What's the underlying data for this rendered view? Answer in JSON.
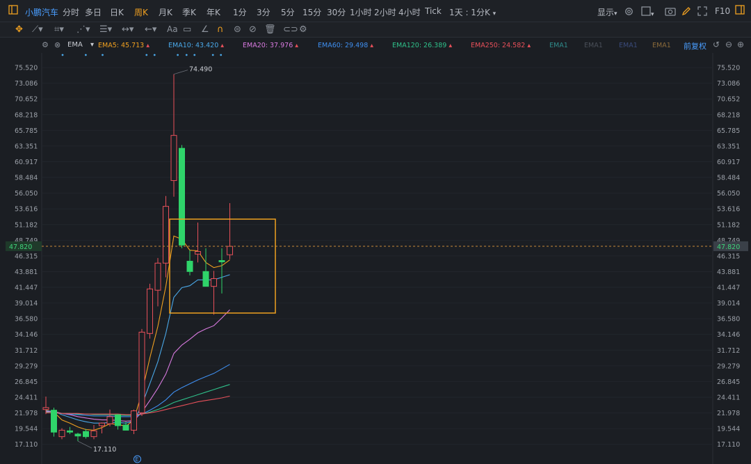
{
  "topbar": {
    "stock_name": "小鹏汽车",
    "periods": [
      "分时",
      "多日",
      "日K",
      "周K",
      "月K",
      "季K",
      "年K",
      "1分",
      "3分",
      "5分",
      "15分",
      "30分",
      "1小时",
      "2小时",
      "4小时",
      "Tick"
    ],
    "active_period": "周K",
    "custom_period": "1天 : 1分K",
    "display_label": "显示",
    "fullscreen_icon": "fullscreen-icon",
    "f10_label": "F10"
  },
  "toolbar": {
    "restore_label": "前复权"
  },
  "legend": {
    "indicator": "EMA",
    "items": [
      {
        "label": "EMA5: 45.713",
        "color": "#f0a020"
      },
      {
        "label": "EMA10: 43.420",
        "color": "#4aa8e8"
      },
      {
        "label": "EMA20: 37.976",
        "color": "#d87adf"
      },
      {
        "label": "EMA60: 29.498",
        "color": "#3f8ff0"
      },
      {
        "label": "EMA120: 26.389",
        "color": "#2fc08a"
      },
      {
        "label": "EMA250: 24.582",
        "color": "#e8505a"
      },
      {
        "label": "EMA1",
        "color": "#2f8a8a"
      },
      {
        "label": "EMA1",
        "color": "#4a4f58"
      },
      {
        "label": "EMA1",
        "color": "#3a4a7a"
      },
      {
        "label": "EMA1",
        "color": "#8a6a3a"
      }
    ]
  },
  "chart_data": {
    "type": "candlestick",
    "ylim": [
      16.0,
      76.5
    ],
    "y_ticks": [
      "75.520",
      "73.086",
      "70.652",
      "68.218",
      "65.785",
      "63.351",
      "60.917",
      "58.484",
      "56.050",
      "53.616",
      "51.182",
      "48.749",
      "46.315",
      "43.881",
      "41.447",
      "39.014",
      "36.580",
      "34.146",
      "31.712",
      "29.279",
      "26.845",
      "24.411",
      "21.978",
      "19.544",
      "17.110"
    ],
    "current_price": "47.820",
    "current_value": 47.82,
    "high_annotation": "74.490",
    "low_annotation": "17.110",
    "event_marker": "E",
    "candles": [
      {
        "o": 22.5,
        "h": 24.5,
        "l": 21.8,
        "c": 22.8
      },
      {
        "o": 22.4,
        "h": 22.8,
        "l": 18.3,
        "c": 19.0
      },
      {
        "o": 18.3,
        "h": 19.6,
        "l": 17.9,
        "c": 19.3
      },
      {
        "o": 19.2,
        "h": 19.8,
        "l": 18.7,
        "c": 19.0
      },
      {
        "o": 18.7,
        "h": 18.9,
        "l": 17.6,
        "c": 18.4
      },
      {
        "o": 19.1,
        "h": 19.5,
        "l": 18.0,
        "c": 18.3
      },
      {
        "o": 18.3,
        "h": 20.1,
        "l": 17.9,
        "c": 19.2
      },
      {
        "o": 20.0,
        "h": 20.5,
        "l": 18.8,
        "c": 20.4
      },
      {
        "o": 20.3,
        "h": 22.5,
        "l": 19.9,
        "c": 21.4
      },
      {
        "o": 21.7,
        "h": 21.8,
        "l": 19.4,
        "c": 20.0
      },
      {
        "o": 20.1,
        "h": 20.6,
        "l": 19.6,
        "c": 19.3
      },
      {
        "o": 19.3,
        "h": 22.5,
        "l": 18.7,
        "c": 22.3
      },
      {
        "o": 22.0,
        "h": 35.0,
        "l": 21.5,
        "c": 34.5
      },
      {
        "o": 34.3,
        "h": 42.0,
        "l": 33.5,
        "c": 41.2
      },
      {
        "o": 41.0,
        "h": 46.0,
        "l": 38.5,
        "c": 45.2
      },
      {
        "o": 45.2,
        "h": 55.6,
        "l": 43.0,
        "c": 54.0
      },
      {
        "o": 58.0,
        "h": 74.49,
        "l": 55.5,
        "c": 65.0
      },
      {
        "o": 63.0,
        "h": 63.5,
        "l": 47.5,
        "c": 48.0
      },
      {
        "o": 45.5,
        "h": 47.2,
        "l": 43.3,
        "c": 43.9
      },
      {
        "o": 46.6,
        "h": 51.5,
        "l": 45.3,
        "c": 47.0
      },
      {
        "o": 43.9,
        "h": 47.5,
        "l": 41.9,
        "c": 41.6
      },
      {
        "o": 41.6,
        "h": 44.0,
        "l": 37.2,
        "c": 42.8
      },
      {
        "o": 45.6,
        "h": 47.5,
        "l": 40.5,
        "c": 45.4
      },
      {
        "o": 46.5,
        "h": 54.5,
        "l": 45.8,
        "c": 47.8
      }
    ],
    "series": [
      {
        "name": "EMA5",
        "color": "#f0a020",
        "values": [
          22.4,
          22.1,
          20.9,
          20.4,
          19.8,
          19.4,
          19.3,
          19.7,
          20.3,
          20.2,
          19.9,
          20.9,
          25.1,
          30.5,
          35.4,
          41.6,
          49.4,
          48.9,
          47.2,
          47.1,
          45.3,
          44.5,
          44.8,
          45.7
        ]
      },
      {
        "name": "EMA10",
        "color": "#4aa8e8",
        "values": [
          22.3,
          22.2,
          21.7,
          21.3,
          20.9,
          20.6,
          20.4,
          20.4,
          20.5,
          20.5,
          20.4,
          20.7,
          23.2,
          26.5,
          29.9,
          34.3,
          39.9,
          41.4,
          41.7,
          42.6,
          42.6,
          42.6,
          43.0,
          43.4
        ]
      },
      {
        "name": "EMA20",
        "color": "#d87adf",
        "values": [
          22.2,
          22.2,
          21.9,
          21.7,
          21.4,
          21.2,
          21.0,
          20.9,
          20.9,
          20.8,
          20.7,
          20.8,
          22.1,
          23.9,
          25.8,
          28.0,
          31.2,
          32.5,
          33.4,
          34.4,
          35.0,
          35.5,
          36.7,
          37.98
        ]
      },
      {
        "name": "EMA60",
        "color": "#3f8ff0",
        "values": [
          22.1,
          22.0,
          21.9,
          21.8,
          21.7,
          21.6,
          21.5,
          21.5,
          21.5,
          21.4,
          21.4,
          21.4,
          21.8,
          22.4,
          23.1,
          24.0,
          25.2,
          25.9,
          26.5,
          27.1,
          27.6,
          28.1,
          28.8,
          29.5
        ]
      },
      {
        "name": "EMA120",
        "color": "#2fc08a",
        "values": [
          22.1,
          22.0,
          21.9,
          21.9,
          21.8,
          21.8,
          21.7,
          21.7,
          21.7,
          21.6,
          21.6,
          21.6,
          21.8,
          22.1,
          22.5,
          23.0,
          23.6,
          24.0,
          24.4,
          24.8,
          25.2,
          25.6,
          26.0,
          26.39
        ]
      },
      {
        "name": "EMA250",
        "color": "#e8505a",
        "values": [
          22.0,
          22.0,
          21.9,
          21.9,
          21.9,
          21.8,
          21.8,
          21.8,
          21.8,
          21.8,
          21.7,
          21.7,
          21.8,
          22.0,
          22.2,
          22.5,
          22.8,
          23.1,
          23.4,
          23.7,
          23.9,
          24.1,
          24.3,
          24.58
        ]
      }
    ]
  }
}
